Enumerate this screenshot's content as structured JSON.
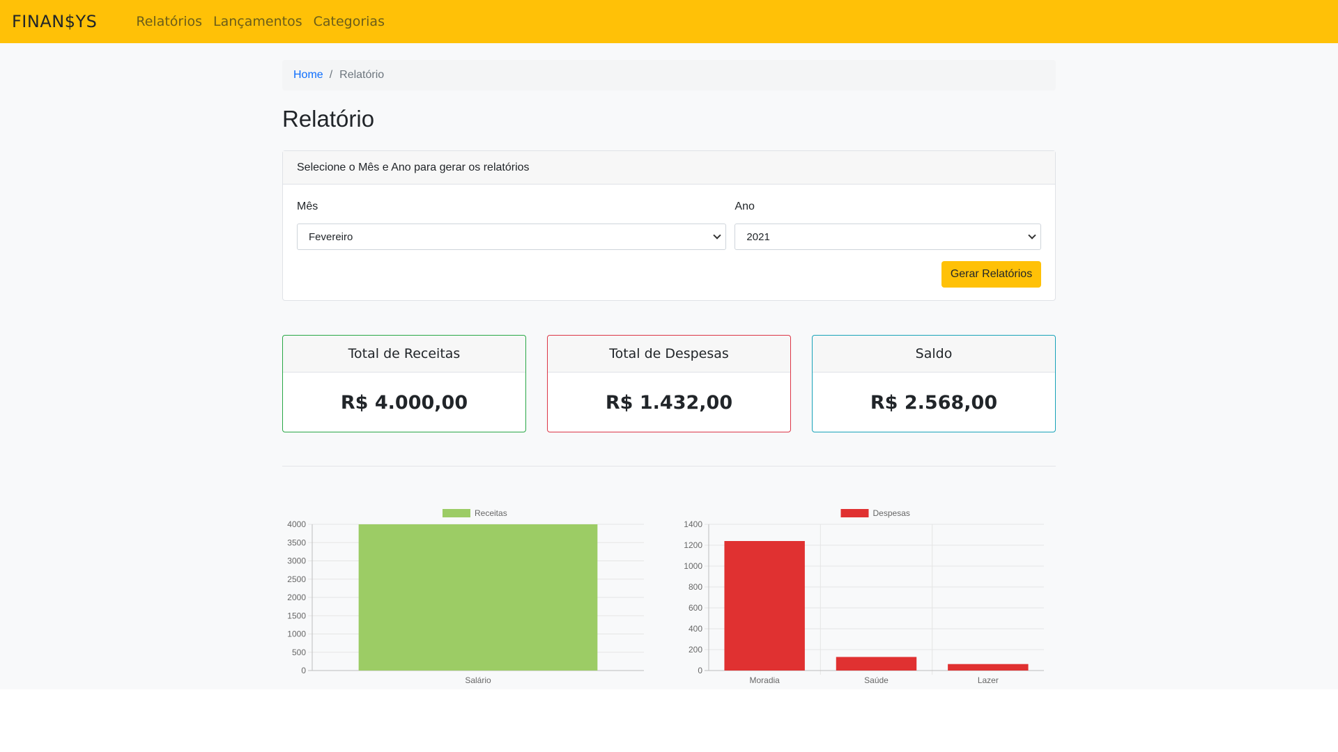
{
  "navbar": {
    "brand": "FINAN$YS",
    "links": [
      "Relatórios",
      "Lançamentos",
      "Categorias"
    ]
  },
  "breadcrumb": {
    "home": "Home",
    "separator": "/",
    "current": "Relatório"
  },
  "page_title": "Relatório",
  "filter_card": {
    "header": "Selecione o Mês e Ano para gerar os relatórios",
    "month_label": "Mês",
    "month_value": "Fevereiro",
    "year_label": "Ano",
    "year_value": "2021",
    "submit_label": "Gerar Relatórios"
  },
  "summary": {
    "receitas": {
      "title": "Total de Receitas",
      "value": "R$ 4.000,00",
      "color": "#28a745"
    },
    "despesas": {
      "title": "Total de Despesas",
      "value": "R$ 1.432,00",
      "color": "#dc3545"
    },
    "saldo": {
      "title": "Saldo",
      "value": "R$ 2.568,00",
      "color": "#17a2b8"
    }
  },
  "chart_data": [
    {
      "type": "bar",
      "categories": [
        "Salário"
      ],
      "series": [
        {
          "name": "Receitas",
          "values": [
            4000
          ],
          "color": "#9ccc65"
        }
      ],
      "ylim": [
        0,
        4000
      ],
      "yticks": [
        0,
        500,
        1000,
        1500,
        2000,
        2500,
        3000,
        3500,
        4000
      ],
      "grid": true,
      "legend": "top"
    },
    {
      "type": "bar",
      "categories": [
        "Moradia",
        "Saúde",
        "Lazer"
      ],
      "series": [
        {
          "name": "Despesas",
          "values": [
            1240,
            130,
            62
          ],
          "color": "#e03131"
        }
      ],
      "ylim": [
        0,
        1400
      ],
      "yticks": [
        0,
        200,
        400,
        600,
        800,
        1000,
        1200,
        1400
      ],
      "grid": true,
      "legend": "top"
    }
  ]
}
